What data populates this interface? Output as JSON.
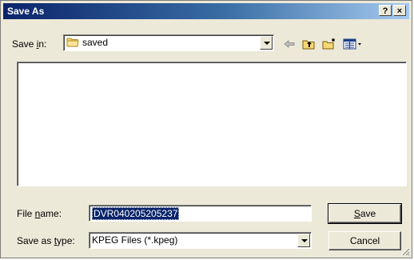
{
  "window": {
    "title": "Save As",
    "help_button": "?",
    "close_button": "×"
  },
  "save_in": {
    "label_pre": "Save ",
    "label_accel": "i",
    "label_post": "n:",
    "value": "saved"
  },
  "toolbar": {
    "icons": [
      "back-arrow-icon",
      "up-one-level-icon",
      "new-folder-icon",
      "view-menu-icon"
    ]
  },
  "file_list": {
    "items": []
  },
  "file_name": {
    "label_pre": "File ",
    "label_accel": "n",
    "label_post": "ame:",
    "value": "DVR040205205237"
  },
  "save_as_type": {
    "label_pre": "Save as ",
    "label_accel": "t",
    "label_post": "ype:",
    "value": "KPEG Files (*.kpeg)"
  },
  "buttons": {
    "save_accel": "S",
    "save_rest": "ave",
    "cancel": "Cancel"
  },
  "colors": {
    "dialog_bg": "#ece9d8",
    "title_gradient_start": "#0a246a",
    "title_gradient_end": "#a6caf0",
    "selection": "#0a246a"
  }
}
